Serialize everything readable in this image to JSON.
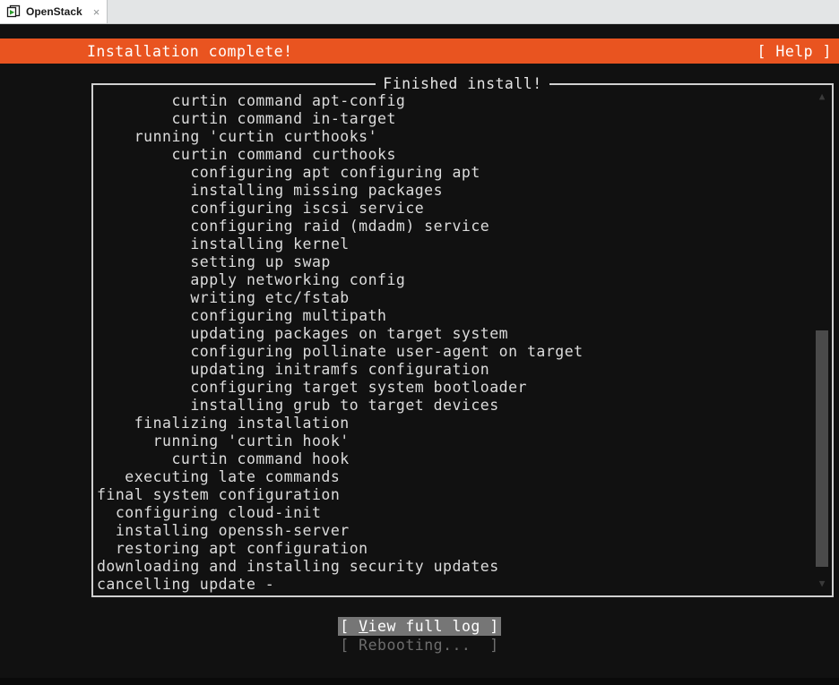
{
  "tab": {
    "title": "OpenStack",
    "icon": "openstack-window-play-icon",
    "close_label": "×"
  },
  "header": {
    "title": "Installation complete!",
    "help_label": "[ Help ]",
    "accent_color": "#e95420"
  },
  "logbox": {
    "legend": "Finished install!",
    "lines": [
      "        curtin command apt-config",
      "        curtin command in-target",
      "    running 'curtin curthooks'",
      "        curtin command curthooks",
      "          configuring apt configuring apt",
      "          installing missing packages",
      "          configuring iscsi service",
      "          configuring raid (mdadm) service",
      "          installing kernel",
      "          setting up swap",
      "          apply networking config",
      "          writing etc/fstab",
      "          configuring multipath",
      "          updating packages on target system",
      "          configuring pollinate user-agent on target",
      "          updating initramfs configuration",
      "          configuring target system bootloader",
      "          installing grub to target devices",
      "    finalizing installation",
      "      running 'curtin hook'",
      "        curtin command hook",
      "   executing late commands",
      "final system configuration",
      "  configuring cloud-init",
      "  installing openssh-server",
      "  restoring apt configuration",
      "downloading and installing security updates",
      "cancelling update -"
    ]
  },
  "scrollbar": {
    "up_arrow": "▲",
    "down_arrow": "▼"
  },
  "buttons": {
    "view_full_log": {
      "prefix": "[ ",
      "accel": "V",
      "rest": "iew full log",
      "suffix": " ]",
      "state": "selected"
    },
    "rebooting": {
      "label": "[ Rebooting...  ]",
      "state": "disabled"
    }
  }
}
